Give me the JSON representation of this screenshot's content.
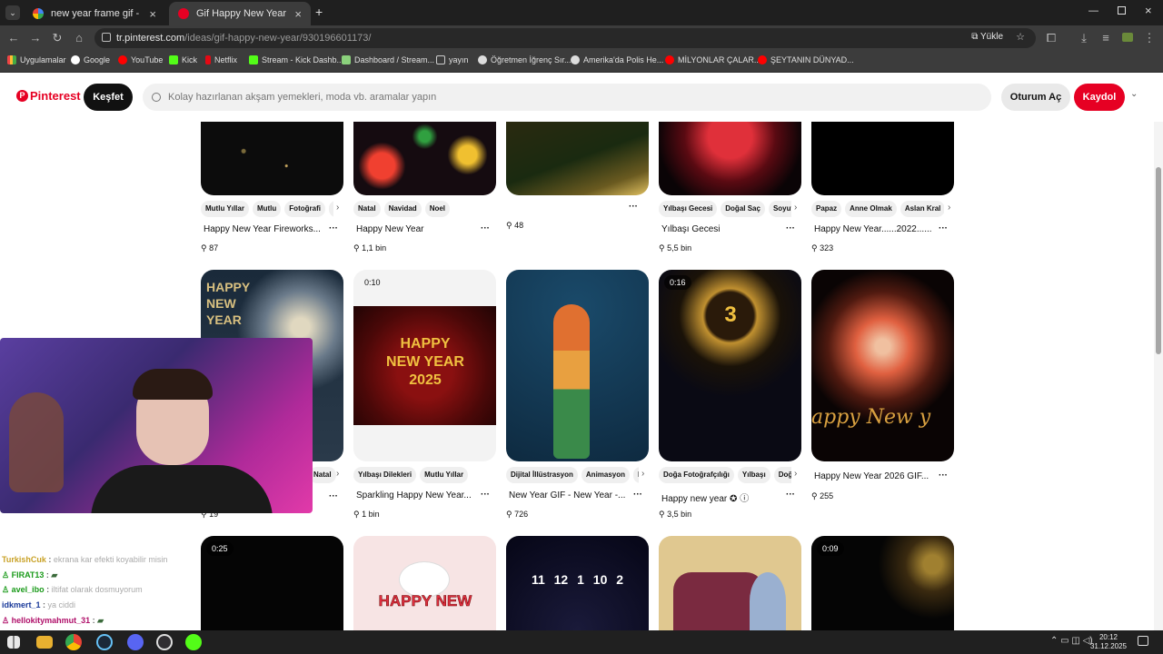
{
  "browser": {
    "tabs": [
      {
        "title": "new year frame gif - Google'da",
        "active": false
      },
      {
        "title": "Gif Happy New Year",
        "active": true
      }
    ],
    "url_domain": "tr.pinterest.com",
    "url_path": "/ideas/gif-happy-new-year/930196601173/",
    "install_label": "Yükle",
    "bookmarks": [
      "Uygulamalar",
      "Google",
      "YouTube",
      "Kick",
      "Netflix",
      "Stream - Kick Dashb...",
      "Dashboard / Stream...",
      "yayın",
      "Öğretmen İğrenç Sır...",
      "Amerika'da Polis He...",
      "MİLYONLAR ÇALAR...",
      "ŞEYTANIN DÜNYAD..."
    ]
  },
  "header": {
    "logo": "Pinterest",
    "explore": "Keşfet",
    "search_placeholder": "Kolay hazırlanan akşam yemekleri, moda vb. aramalar yapın",
    "login": "Oturum Aç",
    "signup": "Kaydol"
  },
  "pins_row1": [
    {
      "tags": [
        "Mutlu Yıllar",
        "Mutlu",
        "Fotoğrafi",
        "N"
      ],
      "title": "Happy New Year Fireworks...",
      "count": "87"
    },
    {
      "tags": [
        "Natal",
        "Navidad",
        "Noel"
      ],
      "title": "Happy New Year",
      "count": "1,1 bin"
    },
    {
      "tags": [],
      "title": "",
      "count": "48"
    },
    {
      "tags": [
        "Yılbaşı Gecesi",
        "Doğal Saç",
        "Soyut"
      ],
      "title": "Yılbaşı Gecesi",
      "count": "5,5 bin"
    },
    {
      "tags": [
        "Papaz",
        "Anne Olmak",
        "Aslan Kral"
      ],
      "title": "Happy New Year......2022.........",
      "count": "323"
    }
  ],
  "pins_row2": [
    {
      "duration": "",
      "image_text": "HAPPY NEW YEAR",
      "tags": [
        "Natal"
      ],
      "title": "",
      "count": "19"
    },
    {
      "duration": "0:10",
      "image_text": "HAPPY NEW YEAR 2025",
      "tags": [
        "Yılbaşı Dilekleri",
        "Mutlu Yıllar"
      ],
      "title": "Sparkling Happy New Year...",
      "count": "1 bin"
    },
    {
      "duration": "",
      "image_text": "",
      "tags": [
        "Dijital İllüstrasyon",
        "Animasyon",
        "R"
      ],
      "title": "New Year GIF - New Year -...",
      "count": "726"
    },
    {
      "duration": "0:16",
      "image_text": "3",
      "tags": [
        "Doğa Fotoğrafçılığı",
        "Yılbaşı",
        "Doğa"
      ],
      "title": "Happy new year",
      "count": "3,5 bin"
    },
    {
      "duration": "",
      "image_text": "appy New y",
      "tags": [],
      "title": "Happy New Year 2026 GIF...",
      "count": "255"
    }
  ],
  "pins_row3": [
    {
      "duration": "0:25",
      "image_text": ""
    },
    {
      "duration": "",
      "image_text": "HAPPY NEW"
    },
    {
      "duration": "",
      "image_text": "11 12 1 10 2"
    },
    {
      "duration": "",
      "image_text": ""
    },
    {
      "duration": "0:09",
      "image_text": ""
    }
  ],
  "chat": [
    {
      "user": "TurkishCuk",
      "msg": "ekrana kar efekti koyabilir misin",
      "color": "#c9a227"
    },
    {
      "user": "FIRAT13",
      "msg": "",
      "color": "#1a9a1a"
    },
    {
      "user": "avel_ibo",
      "msg": "iltifat olarak dosmuyorum",
      "color": "#1a9a1a"
    },
    {
      "user": "idkmert_1",
      "msg": "ya ciddi",
      "color": "#1a3a9a"
    },
    {
      "user": "hellokitymahmut_31",
      "msg": "",
      "color": "#b0106a"
    }
  ],
  "clock": {
    "time": "20:12",
    "date": "31.12.2025"
  },
  "colors": {
    "brand": "#e60023",
    "browser_bg": "#3c3c3c"
  }
}
